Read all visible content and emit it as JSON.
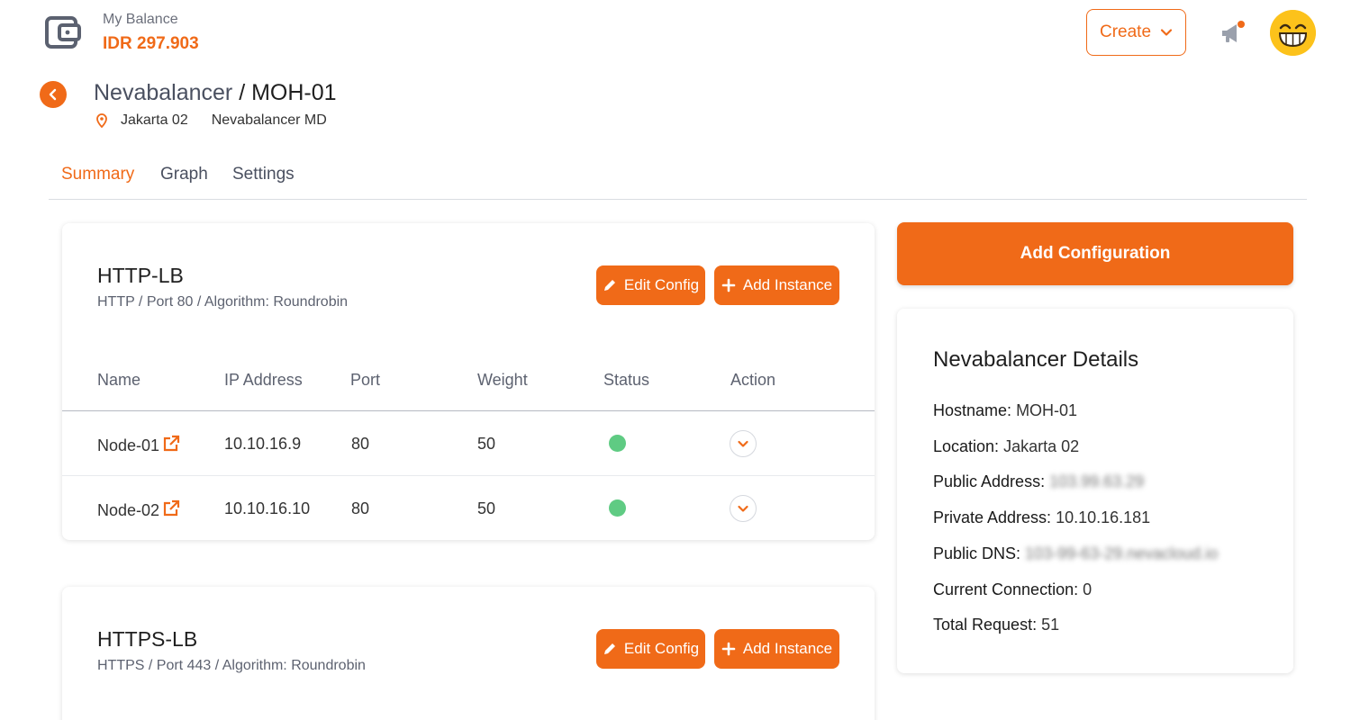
{
  "header": {
    "balance_label": "My Balance",
    "balance_value": "IDR 297.903",
    "create_label": "Create"
  },
  "page": {
    "parent": "Nevabalancer",
    "separator": " / ",
    "name": "MOH-01",
    "location": "Jakarta 02",
    "type": "Nevabalancer MD"
  },
  "tabs": [
    {
      "label": "Summary",
      "active": true
    },
    {
      "label": "Graph",
      "active": false
    },
    {
      "label": "Settings",
      "active": false
    }
  ],
  "load_balancers": [
    {
      "name": "HTTP-LB",
      "subtitle": "HTTP / Port 80 / Algorithm: Roundrobin",
      "edit_label": "Edit Config",
      "add_label": "Add Instance",
      "columns": [
        "Name",
        "IP Address",
        "Port",
        "Weight",
        "Status",
        "Action"
      ],
      "rows": [
        {
          "name": "Node-01",
          "ip": "10.10.16.9",
          "port": "80",
          "weight": "50",
          "status": "active"
        },
        {
          "name": "Node-02",
          "ip": "10.10.16.10",
          "port": "80",
          "weight": "50",
          "status": "active"
        }
      ]
    },
    {
      "name": "HTTPS-LB",
      "subtitle": "HTTPS / Port 443 / Algorithm: Roundrobin",
      "edit_label": "Edit Config",
      "add_label": "Add Instance"
    }
  ],
  "add_configuration_label": "Add Configuration",
  "details": {
    "title": "Nevabalancer Details",
    "rows": [
      {
        "key": "Hostname:",
        "value": "MOH-01"
      },
      {
        "key": "Location:",
        "value": "Jakarta 02"
      },
      {
        "key": "Public Address:",
        "value": "103.99.63.29"
      },
      {
        "key": "Private Address:",
        "value": "10.10.16.181"
      },
      {
        "key": "Public DNS:",
        "value": "103-99-63-29.nevacloud.io"
      },
      {
        "key": "Current Connection:",
        "value": "0"
      },
      {
        "key": "Total Request:",
        "value": "51"
      }
    ]
  },
  "colors": {
    "accent": "#f06a18",
    "status_active": "#5fcb83"
  },
  "icons": [
    "wallet-icon",
    "chevron-down-icon",
    "megaphone-icon",
    "avatar-grin-icon",
    "back-arrow-icon",
    "location-pin-icon",
    "pencil-icon",
    "plus-icon",
    "external-link-icon"
  ]
}
